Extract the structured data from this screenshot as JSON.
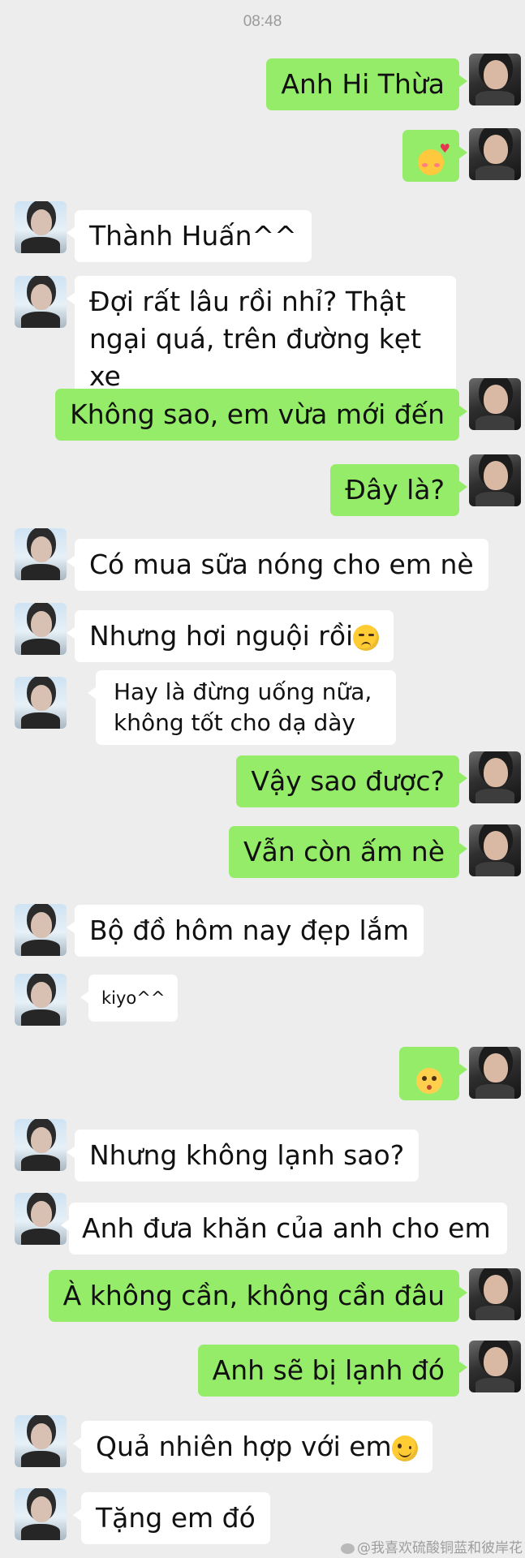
{
  "status": {
    "time": "08:48"
  },
  "messages": [
    {
      "side": "self",
      "text": "Anh Hi Thừa"
    },
    {
      "side": "self",
      "text": "",
      "emoji": "smiling-face-with-hearts"
    },
    {
      "side": "other",
      "text": "Thành Huấn^^"
    },
    {
      "side": "other",
      "text": "Đợi rất lâu rồi nhỉ? Thật ngại quá, trên đường kẹt xe"
    },
    {
      "side": "self",
      "text": "Không sao, em vừa mới đến"
    },
    {
      "side": "self",
      "text": "Đây là?"
    },
    {
      "side": "other",
      "text": "Có mua sữa nóng cho em nè"
    },
    {
      "side": "other",
      "text": "Nhưng hơi nguội rồi",
      "emoji": "disappointed-face"
    },
    {
      "side": "other",
      "text": "Hay là đừng uống nữa, không tốt cho dạ dày"
    },
    {
      "side": "self",
      "text": "Vậy sao được?"
    },
    {
      "side": "self",
      "text": "Vẫn còn ấm nè"
    },
    {
      "side": "other",
      "text": "Bộ đồ hôm nay đẹp lắm"
    },
    {
      "side": "other",
      "text": "kiyo^^"
    },
    {
      "side": "self",
      "text": "",
      "emoji": "pouting-face"
    },
    {
      "side": "other",
      "text": "Nhưng không lạnh sao?"
    },
    {
      "side": "other",
      "text": "Anh đưa khăn của anh cho em"
    },
    {
      "side": "self",
      "text": "À không cần, không cần đâu"
    },
    {
      "side": "self",
      "text": "Anh sẽ bị lạnh đó"
    },
    {
      "side": "other",
      "text": "Quả nhiên hợp với em",
      "emoji": "winking-face"
    },
    {
      "side": "other",
      "text": "Tặng em đó"
    }
  ],
  "watermark": "@我喜欢硫酸铜蓝和彼岸花",
  "colors": {
    "background": "#ededed",
    "self_bubble": "#95ec69",
    "other_bubble": "#ffffff",
    "time_text": "#9a9a9a"
  }
}
